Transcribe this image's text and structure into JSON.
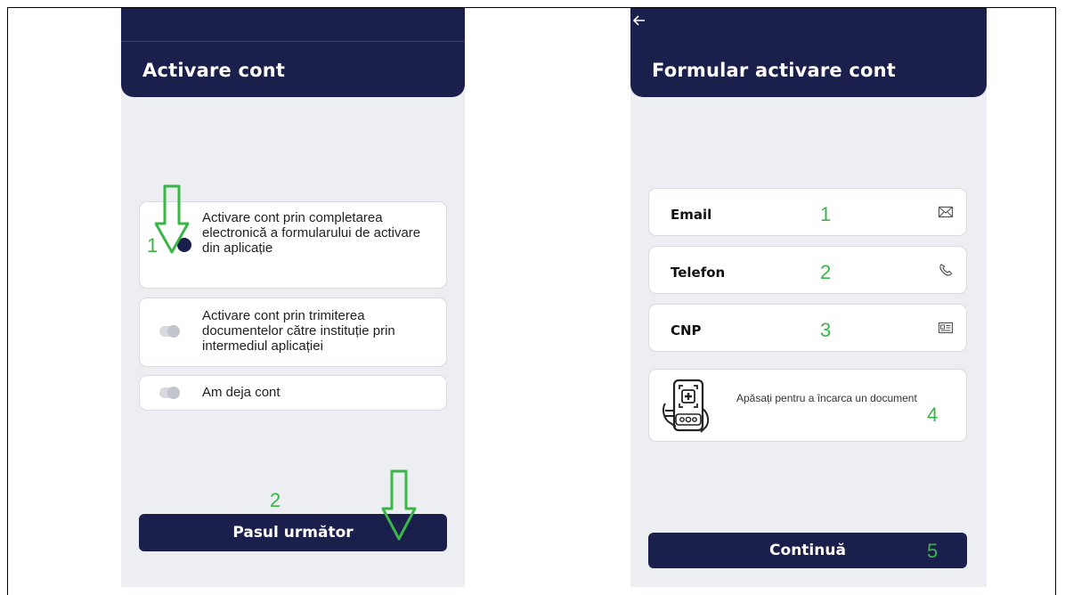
{
  "left_screen": {
    "title": "Activare cont",
    "options": [
      {
        "label": "Activare cont prin completarea electronică a formularului de activare din aplicație",
        "selected": true
      },
      {
        "label": "Activare cont prin trimiterea documentelor către instituție prin intermediul aplicației",
        "selected": false
      },
      {
        "label": "Am deja cont",
        "selected": false
      }
    ],
    "next_button": "Pasul următor",
    "annotations": {
      "n1": "1",
      "n2": "2"
    }
  },
  "right_screen": {
    "back_icon": "arrow-left-icon",
    "title": "Formular activare cont",
    "fields": [
      {
        "label": "Email",
        "icon": "mail-icon",
        "annotation": "1"
      },
      {
        "label": "Telefon",
        "icon": "phone-icon",
        "annotation": "2"
      },
      {
        "label": "CNP",
        "icon": "id-card-icon",
        "annotation": "3"
      }
    ],
    "upload": {
      "text": "Apăsați pentru a încarca un document",
      "icon": "upload-document-icon",
      "annotation": "4"
    },
    "continue_button": "Continuă",
    "continue_annotation": "5"
  },
  "colors": {
    "navy": "#1b1f4b",
    "background": "#eceef2",
    "annotation_green": "#3bb54a"
  }
}
